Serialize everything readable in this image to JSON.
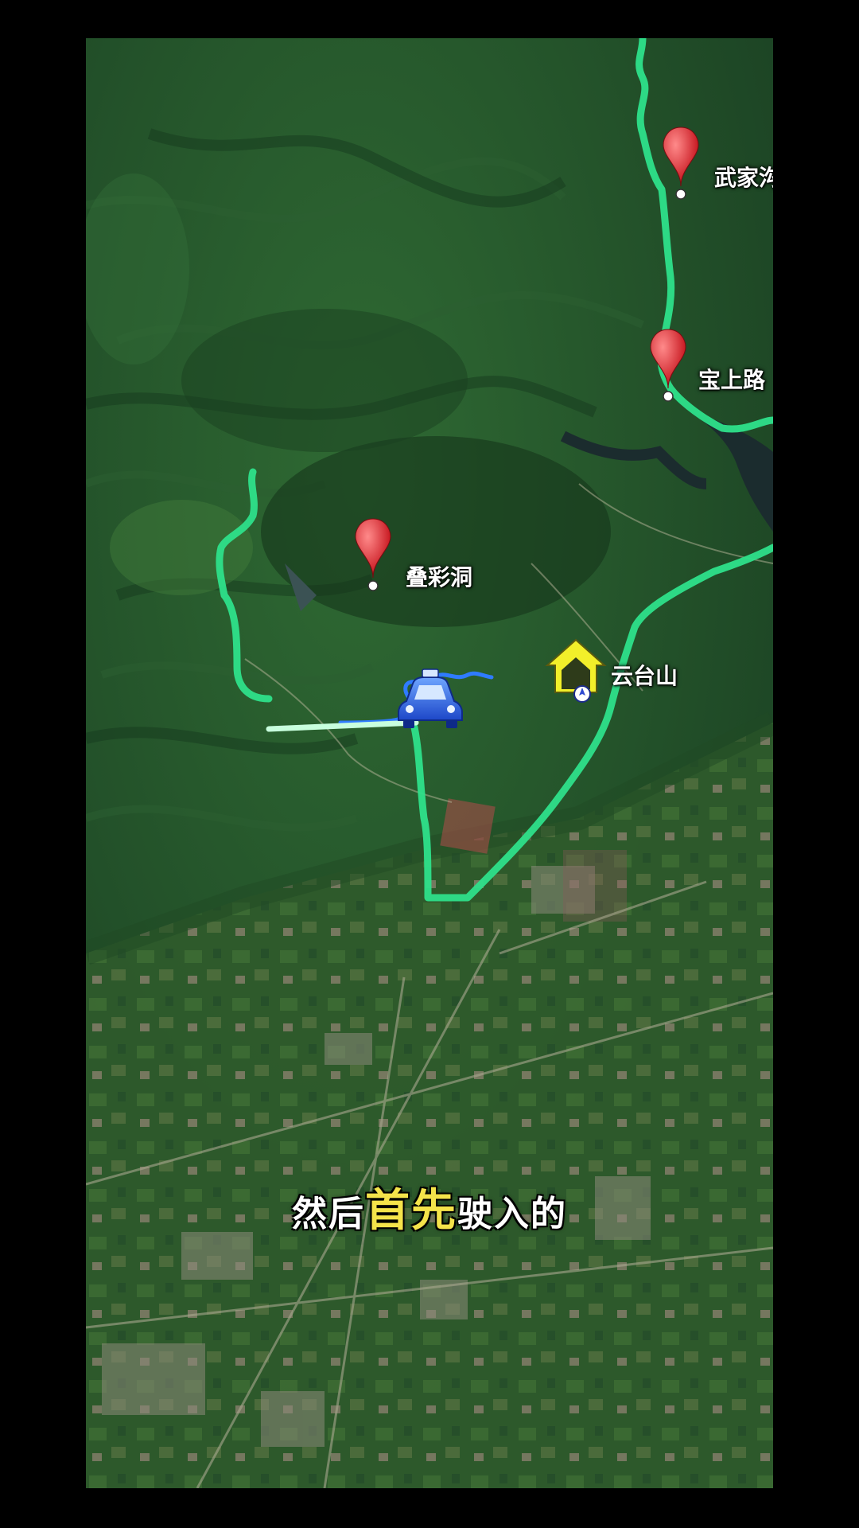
{
  "map": {
    "places": [
      {
        "name": "武家沟",
        "icon": "red-pin-icon"
      },
      {
        "name": "宝上路",
        "icon": "red-pin-icon"
      },
      {
        "name": "叠彩洞",
        "icon": "red-pin-icon"
      },
      {
        "name": "云台山",
        "icon": "house-icon"
      }
    ],
    "vehicle_icon": "car-icon",
    "route_color": "#2ee08a",
    "current_route_color": "#2f7bff",
    "water_color": "#1b2c2e"
  },
  "subtitle": {
    "part1": "然后",
    "highlight": "首先",
    "part2": "驶入的",
    "highlight_color": "#f4e34a"
  }
}
